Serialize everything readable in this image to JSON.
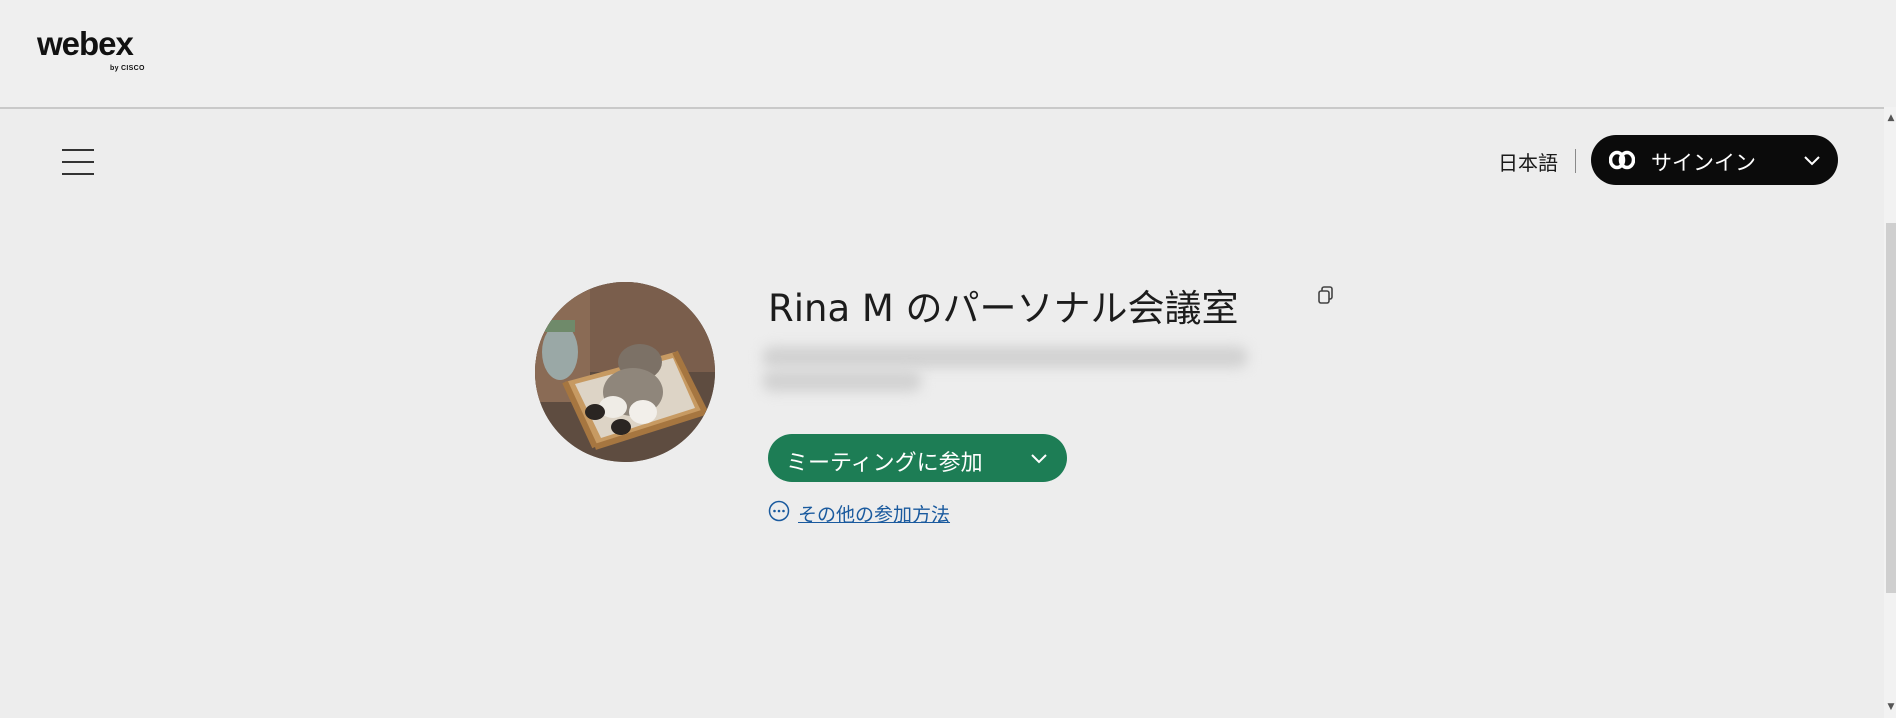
{
  "header": {
    "logo_text": "webex",
    "logo_sub": "by CISCO"
  },
  "toolbar": {
    "menu_icon": "hamburger-menu-icon",
    "language_label": "日本語",
    "signin_label": "サインイン",
    "signin_icon": "webex-logo-icon",
    "signin_chevron_icon": "chevron-down-icon"
  },
  "room": {
    "title": "Rina M のパーソナル会議室",
    "copy_icon": "copy-icon",
    "avatar": "profile-photo-cat",
    "join_label": "ミーティングに参加",
    "join_chevron_icon": "chevron-down-icon",
    "other_ways_label": "その他の参加方法",
    "other_ways_icon": "more-circle-icon"
  },
  "colors": {
    "background": "#ededed",
    "signin_bg": "#0b0b0b",
    "join_bg": "#1d7d55",
    "link": "#1a5a9e"
  }
}
